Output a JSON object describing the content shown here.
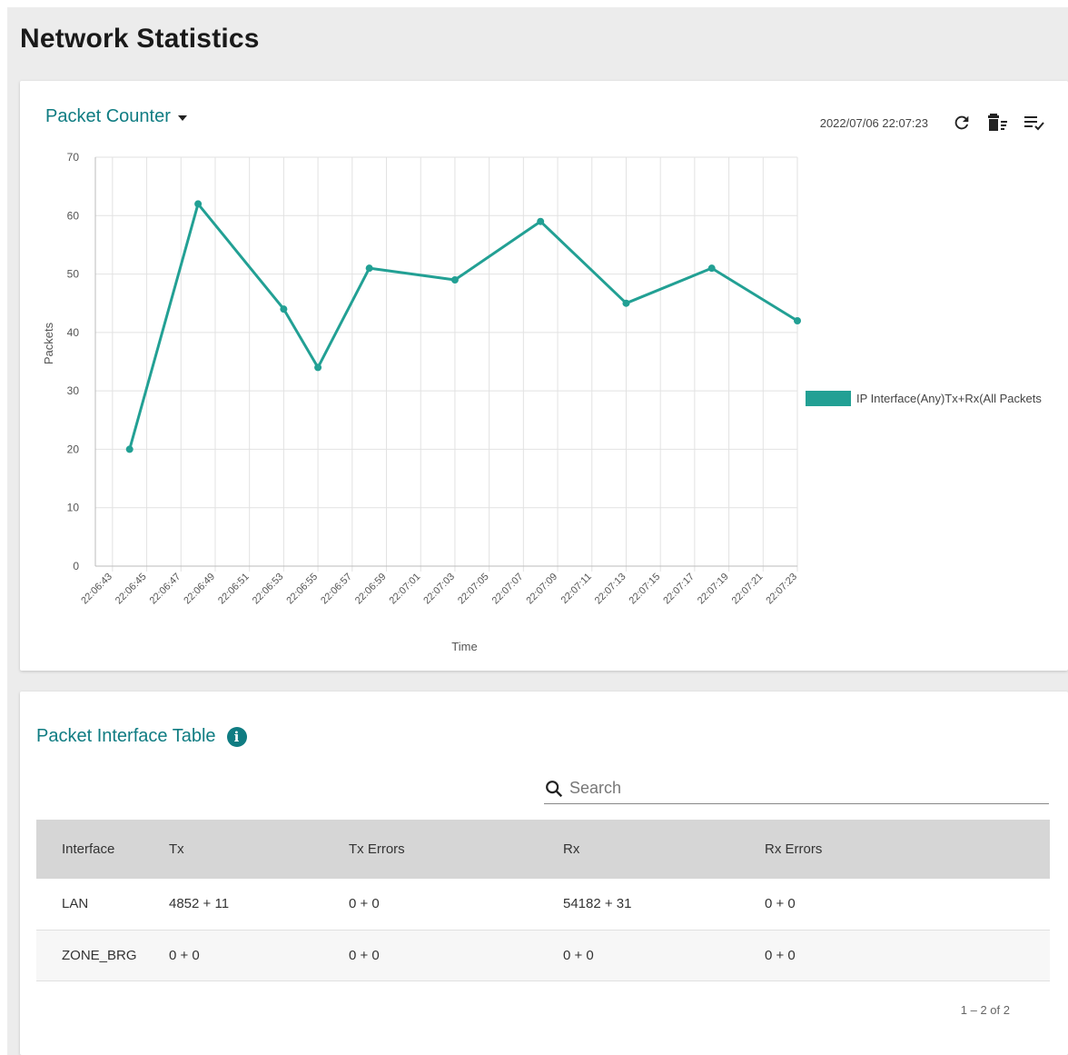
{
  "page": {
    "title": "Network Statistics"
  },
  "chart_card": {
    "title": "Packet Counter",
    "timestamp": "2022/07/06 22:07:23",
    "icons": [
      "refresh-icon",
      "delete-icon",
      "list-check-icon"
    ]
  },
  "chart_data": {
    "type": "line",
    "xlabel": "Time",
    "ylabel": "Packets",
    "ylim": [
      0,
      70
    ],
    "yticks": [
      0,
      10,
      20,
      30,
      40,
      50,
      60,
      70
    ],
    "x_ticks": [
      "22:06:43",
      "22:06:45",
      "22:06:47",
      "22:06:49",
      "22:06:51",
      "22:06:53",
      "22:06:55",
      "22:06:57",
      "22:06:59",
      "22:07:01",
      "22:07:03",
      "22:07:05",
      "22:07:07",
      "22:07:09",
      "22:07:11",
      "22:07:13",
      "22:07:15",
      "22:07:17",
      "22:07:19",
      "22:07:21",
      "22:07:23"
    ],
    "grid": true,
    "legend_position": "right",
    "series": [
      {
        "name": "IP Interface(Any)Tx+Rx(All Packets",
        "color": "#22a094",
        "points": [
          {
            "x": "22:06:44",
            "y": 20
          },
          {
            "x": "22:06:48",
            "y": 62
          },
          {
            "x": "22:06:53",
            "y": 44
          },
          {
            "x": "22:06:55",
            "y": 34
          },
          {
            "x": "22:06:58",
            "y": 51
          },
          {
            "x": "22:07:03",
            "y": 49
          },
          {
            "x": "22:07:08",
            "y": 59
          },
          {
            "x": "22:07:13",
            "y": 45
          },
          {
            "x": "22:07:18",
            "y": 51
          },
          {
            "x": "22:07:23",
            "y": 42
          }
        ]
      }
    ]
  },
  "table_card": {
    "title": "Packet Interface Table",
    "search_placeholder": "Search",
    "columns": [
      "Interface",
      "Tx",
      "Tx Errors",
      "Rx",
      "Rx Errors"
    ],
    "rows": [
      [
        "LAN",
        "4852 + 11",
        "0 + 0",
        "54182 + 31",
        "0 + 0"
      ],
      [
        "ZONE_BRG",
        "0 + 0",
        "0 + 0",
        "0 + 0",
        "0 + 0"
      ]
    ],
    "pagination": "1 – 2 of 2"
  }
}
